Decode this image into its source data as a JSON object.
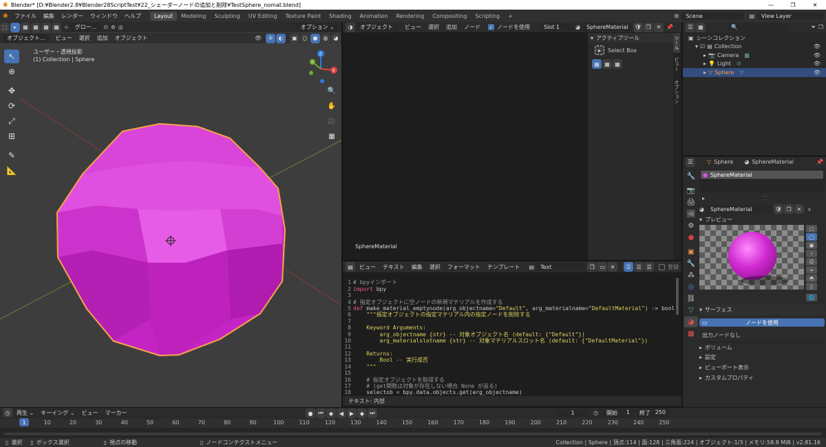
{
  "window": {
    "title": "Blender* [D:¥Blender2.8¥Blender28ScriptTest¥22_シェーダーノードの追加と削除¥TestSphere_nomat.blend]",
    "controls": [
      "—",
      "❐",
      "✕"
    ]
  },
  "menu": {
    "items": [
      "ファイル",
      "編集",
      "レンダー",
      "ウィンドウ",
      "ヘルプ"
    ]
  },
  "workspaces": [
    "Layout",
    "Modeling",
    "Sculpting",
    "UV Editing",
    "Texture Paint",
    "Shading",
    "Animation",
    "Rendering",
    "Compositing",
    "Scripting",
    "+"
  ],
  "scene": {
    "name": "Scene",
    "view_layer": "View Layer"
  },
  "viewport": {
    "mode": "オブジェクト...",
    "menus": [
      "ビュー",
      "選択",
      "追加",
      "オブジェクト"
    ],
    "transform": "グロー...",
    "options": "オプション ⌄",
    "view_name": "ユーザー・透視投影",
    "collection_info": "(1) Collection | Sphere",
    "gizmo": {
      "x": "X",
      "y": "Y",
      "z": "Z"
    }
  },
  "node_editor": {
    "mode": "オブジェクト",
    "menus": [
      "ビュー",
      "選択",
      "追加",
      "ノード"
    ],
    "use_nodes_label": "ノードを使用",
    "slot": "Slot 1",
    "material": "SphereMaterial",
    "canvas_label": "SphereMaterial",
    "sidebar": {
      "title": "アクティブツール",
      "tool": "Select Box"
    },
    "side_tabs": [
      "ツール",
      "ビュー",
      "オプション"
    ]
  },
  "text_editor": {
    "menus": [
      "ビュー",
      "テキスト",
      "編集",
      "選択",
      "フォーマット",
      "テンプレート"
    ],
    "file": "Text",
    "register": "登録",
    "footer": "テキスト: 内部"
  },
  "outliner": {
    "root": "シーンコレクション",
    "items": [
      {
        "name": "Collection",
        "indent": 1
      },
      {
        "name": "Camera",
        "indent": 2
      },
      {
        "name": "Light",
        "indent": 2
      },
      {
        "name": "Sphere",
        "indent": 2,
        "selected": true
      }
    ]
  },
  "properties": {
    "object": "Sphere",
    "material": "SphereMaterial",
    "slot_item": "SphereMaterial",
    "datablock": "SphereMaterial",
    "preview_title": "プレビュー",
    "surface_title": "サーフェス",
    "use_nodes": "ノードを使用",
    "output": "出力ノードなし",
    "sections": [
      "ボリューム",
      "設定",
      "ビューポート表示",
      "カスタムプロパティ"
    ]
  },
  "timeline": {
    "menus": [
      "再生 ⌄",
      "キーイング ⌄",
      "ビュー",
      "マーカー"
    ],
    "current": "1",
    "start_label": "開始",
    "start": "1",
    "end_label": "終了",
    "end": "250",
    "ticks": [
      "1",
      "10",
      "20",
      "30",
      "40",
      "50",
      "60",
      "70",
      "80",
      "90",
      "100",
      "110",
      "120",
      "130",
      "140",
      "150",
      "160",
      "170",
      "180",
      "190",
      "200",
      "210",
      "220",
      "230",
      "240",
      "250"
    ]
  },
  "status": {
    "left": [
      "選択",
      "ボックス選択",
      "視点の移動",
      "ノードコンテクストメニュー"
    ],
    "right": "Collection | Sphere | 頂点:114 | 面:128 | 三角面:224 | オブジェクト:1/3 | メモリ:58.8 MiB | v2.81.16"
  },
  "colors": {
    "accent": "#4772b3",
    "sphere": "#d02ad0",
    "outline": "#f5a04a",
    "keyword": "#e6598a",
    "string": "#dcd35f"
  }
}
